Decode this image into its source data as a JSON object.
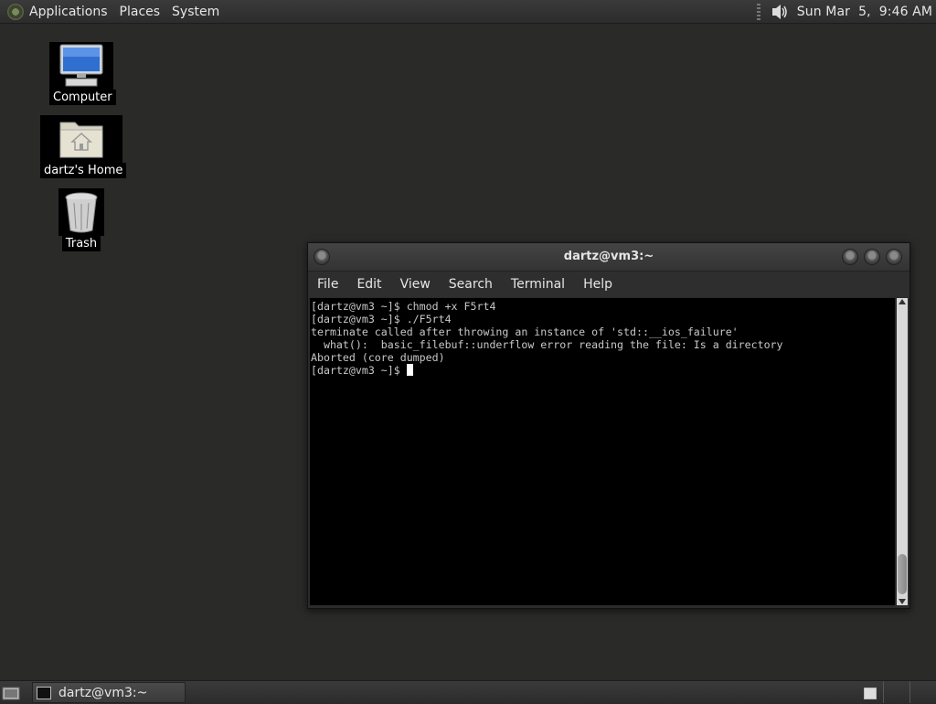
{
  "top_panel": {
    "menus": [
      "Applications",
      "Places",
      "System"
    ],
    "clock": "Sun Mar  5,  9:46 AM"
  },
  "desktop": {
    "icons": [
      {
        "label": "Computer",
        "icon": "computer-icon"
      },
      {
        "label": "dartz's Home",
        "icon": "home-folder-icon"
      },
      {
        "label": "Trash",
        "icon": "trash-icon"
      }
    ]
  },
  "terminal": {
    "title": "dartz@vm3:~",
    "menus": [
      "File",
      "Edit",
      "View",
      "Search",
      "Terminal",
      "Help"
    ],
    "lines": [
      "[dartz@vm3 ~]$ chmod +x F5rt4",
      "[dartz@vm3 ~]$ ./F5rt4",
      "terminate called after throwing an instance of 'std::__ios_failure'",
      "  what():  basic_filebuf::underflow error reading the file: Is a directory",
      "Aborted (core dumped)",
      "[dartz@vm3 ~]$ "
    ]
  },
  "taskbar": {
    "window_button": "dartz@vm3:~"
  },
  "colors": {
    "desktop_bg": "#2a2a28",
    "terminal_bg": "#000000",
    "terminal_fg": "#c8c8c8"
  }
}
